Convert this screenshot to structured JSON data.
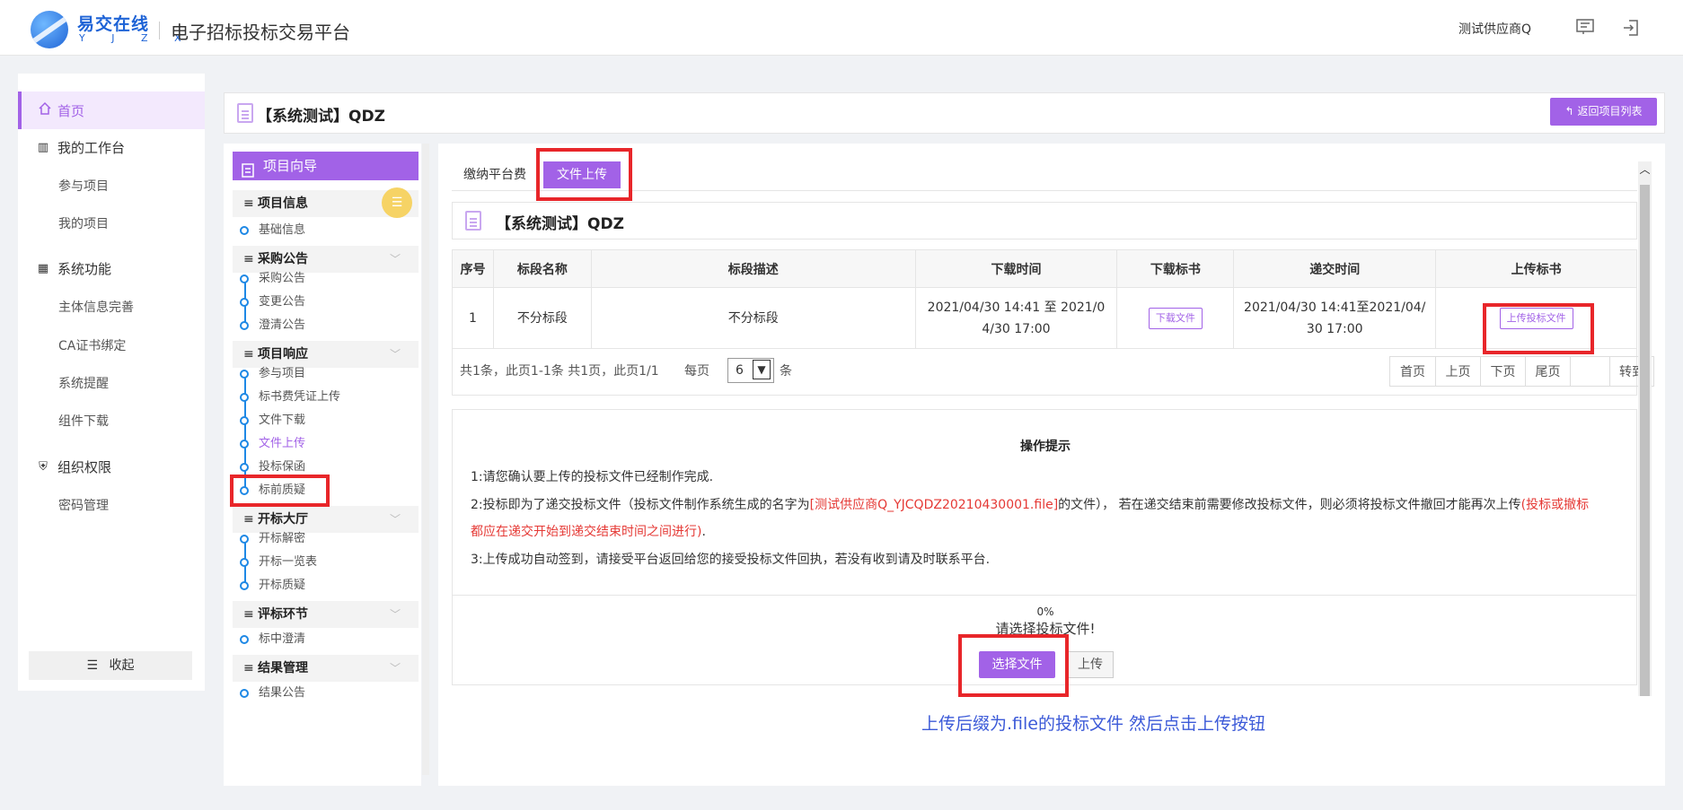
{
  "header": {
    "brand_cn": "易交在线",
    "brand_en": "Y J Z X",
    "platform": "电子招标投标交易平台",
    "user": "测试供应商Q"
  },
  "leftnav": {
    "home": "首页",
    "workbench": "我的工作台",
    "join_project": "参与项目",
    "my_project": "我的项目",
    "system_func": "系统功能",
    "entity_info": "主体信息完善",
    "ca_bind": "CA证书绑定",
    "sys_remind": "系统提醒",
    "component_download": "组件下载",
    "org_perm": "组织权限",
    "password_mgmt": "密码管理",
    "collapse": "收起"
  },
  "page": {
    "title": "【系统测试】QDZ",
    "back_button": "返回项目列表"
  },
  "wizard": {
    "head": "项目向导",
    "groups": {
      "project_info": "项目信息",
      "procure_notice": "采购公告",
      "project_response": "项目响应",
      "bid_hall": "开标大厅",
      "evaluation": "评标环节",
      "result_mgmt": "结果管理"
    },
    "items": {
      "basic_info": "基础信息",
      "procure_notice": "采购公告",
      "change_notice": "变更公告",
      "clarify_notice": "澄清公告",
      "join_project": "参与项目",
      "fee_voucher": "标书费凭证上传",
      "file_download": "文件下载",
      "file_upload": "文件上传",
      "bid_bond": "投标保函",
      "pre_bid_question": "标前质疑",
      "bid_decrypt": "开标解密",
      "bid_overview": "开标一览表",
      "bid_question": "开标质疑",
      "mid_clarify": "标中澄清",
      "result_notice": "结果公告"
    }
  },
  "tabs": {
    "pay_fee": "缴纳平台费",
    "file_upload": "文件上传"
  },
  "project_card_title": "【系统测试】QDZ",
  "table": {
    "headers": [
      "序号",
      "标段名称",
      "标段描述",
      "下载时间",
      "下载标书",
      "递交时间",
      "上传标书"
    ],
    "row": {
      "index": "1",
      "name": "不分标段",
      "desc": "不分标段",
      "download_time_1": "2021/04/30 14:41 至 2021/0",
      "download_time_2": "4/30 17:00",
      "download_btn": "下载文件",
      "submit_time_1": "2021/04/30 14:41至2021/04/",
      "submit_time_2": "30 17:00",
      "upload_btn": "上传投标文件"
    }
  },
  "pager": {
    "info": "共1条，此页1-1条 共1页，此页1/1",
    "per_page_label": "每页",
    "per_page_value": "6",
    "unit": "条",
    "first": "首页",
    "prev": "上页",
    "next": "下页",
    "last": "尾页",
    "goto": "转到"
  },
  "tips": {
    "title": "操作提示",
    "line1": "1:请您确认要上传的投标文件已经制作完成.",
    "line2_a": "2:投标即为了递交投标文件（投标文件制作系统生成的名字为",
    "line2_red1": "[测试供应商Q_YJCQDZ20210430001.file]",
    "line2_b": "的文件）， 若在递交结束前需要修改投标文件，则必须将投标文件撤回才能再次上传",
    "line2_red2": "(投标或撤标",
    "line2_red3": "都应在递交开始到递交结束时间之间进行)",
    "line2_c": ".",
    "line3": "3:上传成功自动签到，请接受平台返回给您的接受投标文件回执，若没有收到请及时联系平台."
  },
  "upload": {
    "percent": "0%",
    "prompt": "请选择投标文件!",
    "choose_btn": "选择文件",
    "upload_btn": "上传"
  },
  "hint": "上传后缀为.file的投标文件 然后点击上传按钮",
  "colors": {
    "accent": "#a262e7",
    "highlight": "#e8262a",
    "hint_blue": "#3c5ad8"
  }
}
